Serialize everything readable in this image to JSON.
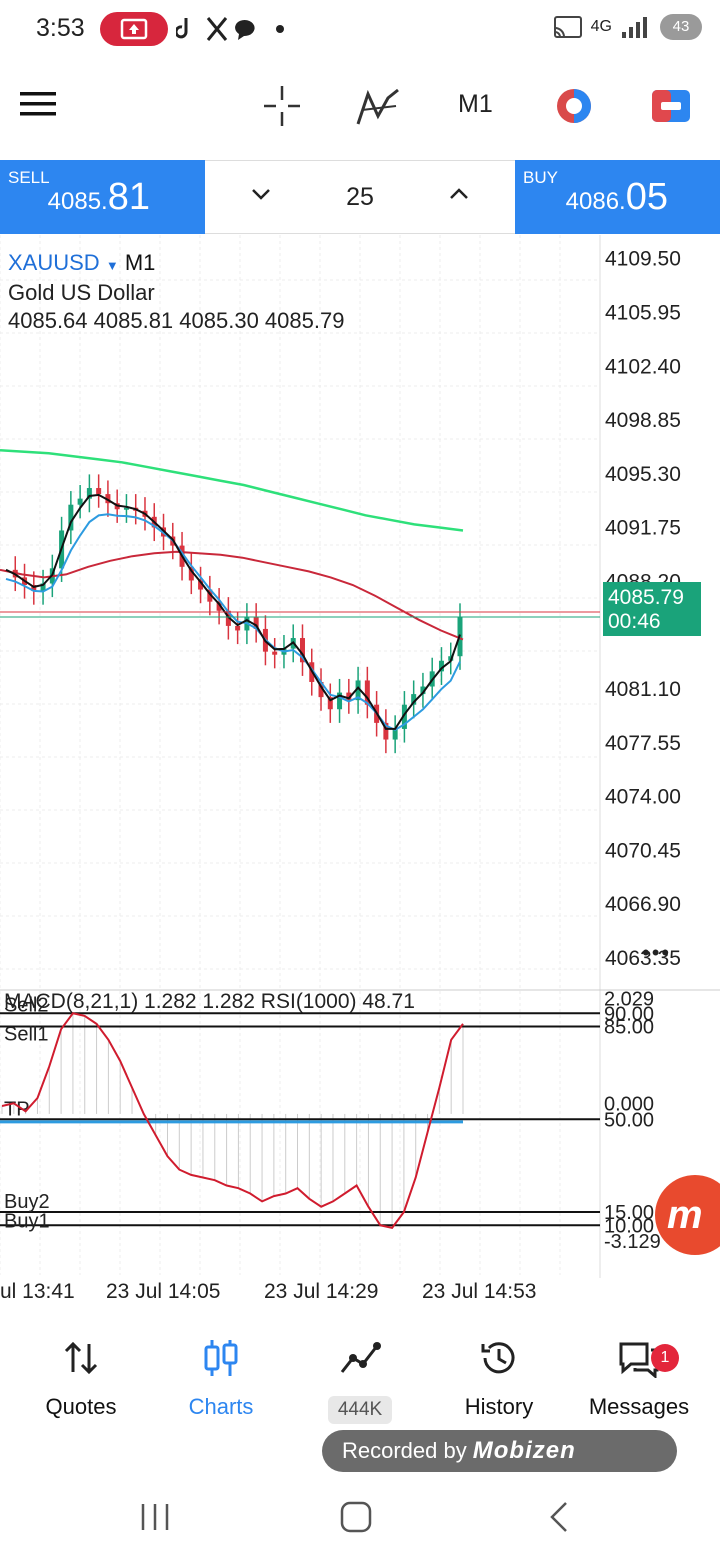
{
  "status_bar": {
    "time": "3:53",
    "network": "4G",
    "battery": "43"
  },
  "toolbar": {
    "timeframe": "M1"
  },
  "trade": {
    "sell_label": "SELL",
    "sell_price_main": "4085.",
    "sell_price_big": "81",
    "buy_label": "BUY",
    "buy_price_main": "4086.",
    "buy_price_big": "05",
    "volume": "25"
  },
  "symbol": {
    "name": "XAUUSD",
    "timeframe": "M1",
    "description": "Gold US Dollar",
    "ohlc": "4085.64 4085.81 4085.30 4085.79"
  },
  "price_axis": [
    "4109.50",
    "4105.95",
    "4102.40",
    "4098.85",
    "4095.30",
    "4091.75",
    "4088.20",
    "4081.10",
    "4077.55",
    "4074.00",
    "4070.45",
    "4066.90",
    "4063.35"
  ],
  "current_price": {
    "price": "4085.79",
    "countdown": "00:46"
  },
  "indicator": {
    "label": "MACD(8,21,1) 1.282 1.282 RSI(1000) 48.71",
    "levels": [
      "2.029",
      "90.00",
      "85.00",
      "0.000",
      "50.00",
      "15.00",
      "10.00",
      "-3.129"
    ],
    "lines": [
      "Sell2",
      "Sell1",
      "TP",
      "Buy2",
      "Buy1"
    ]
  },
  "time_axis": [
    "ul 13:41",
    "23 Jul 14:05",
    "23 Jul 14:29",
    "23 Jul 14:53"
  ],
  "nav": {
    "quotes": "Quotes",
    "charts": "Charts",
    "trade_badge": "444K",
    "history": "History",
    "messages": "Messages",
    "messages_badge": "1"
  },
  "overlay": {
    "recorded_by": "Recorded by",
    "brand": "Mobizen",
    "fab_glyph": "m"
  },
  "chart_data": {
    "type": "candlestick",
    "ylim": [
      4061.5,
      4111.0
    ],
    "close_series": [
      4088.9,
      4088.4,
      4087.9,
      4087.5,
      4088.0,
      4089.0,
      4091.5,
      4093.2,
      4093.6,
      4094.3,
      4093.9,
      4093.3,
      4092.9,
      4093.0,
      4092.8,
      4092.4,
      4091.7,
      4091.1,
      4090.5,
      4089.1,
      4088.2,
      4087.6,
      4086.8,
      4086.2,
      4085.2,
      4084.9,
      4085.8,
      4085.0,
      4083.5,
      4083.3,
      4083.7,
      4084.4,
      4082.8,
      4081.5,
      4080.5,
      4079.7,
      4080.8,
      4080.3,
      4081.6,
      4080.0,
      4078.8,
      4077.7,
      4078.4,
      4080.0,
      4080.7,
      4081.2,
      4082.2,
      4082.9,
      4083.2,
      4085.79
    ],
    "ma_green": [
      4096.8,
      4096.7,
      4096.6,
      4096.4,
      4096.2,
      4096.0,
      4095.7,
      4095.4,
      4095.1,
      4094.8,
      4094.5,
      4094.1,
      4093.7,
      4093.3,
      4092.9,
      4092.5,
      4092.2,
      4091.9,
      4091.7,
      4091.5
    ],
    "ma_red": [
      4088.9,
      4088.6,
      4088.4,
      4088.6,
      4089.1,
      4089.5,
      4089.8,
      4090.0,
      4090.1,
      4090.0,
      4089.9,
      4089.7,
      4089.4,
      4089.1,
      4088.8,
      4088.4,
      4087.9,
      4087.2,
      4086.4,
      4085.6,
      4084.9,
      4084.3
    ],
    "rsi_series": [
      55,
      56,
      53,
      58,
      70,
      84,
      90,
      89,
      86,
      80,
      72,
      62,
      52,
      44,
      36,
      31,
      29,
      28,
      27,
      25,
      24,
      22,
      19,
      21,
      22,
      24,
      20,
      17,
      19,
      22,
      25,
      17,
      10,
      9,
      15,
      28,
      45,
      62,
      80,
      86
    ]
  }
}
